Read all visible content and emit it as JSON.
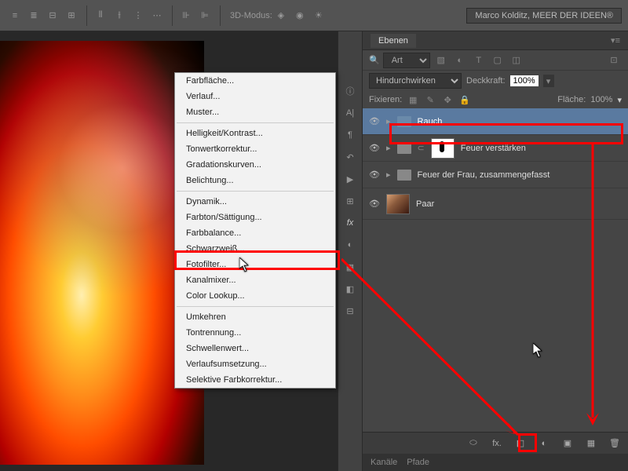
{
  "top": {
    "mode3d_label": "3D-Modus:",
    "author": "Marco Kolditz, MEER DER IDEEN®"
  },
  "context_menu": {
    "items": [
      "Farbfläche...",
      "Verlauf...",
      "Muster...",
      "Helligkeit/Kontrast...",
      "Tonwertkorrektur...",
      "Gradationskurven...",
      "Belichtung...",
      "Dynamik...",
      "Farbton/Sättigung...",
      "Farbbalance...",
      "Schwarzweiß...",
      "Fotofilter...",
      "Kanalmixer...",
      "Color Lookup...",
      "Umkehren",
      "Tontrennung...",
      "Schwellenwert...",
      "Verlaufsumsetzung...",
      "Selektive Farbkorrektur..."
    ],
    "highlighted_index": 9,
    "separators_after": [
      2,
      6,
      13
    ]
  },
  "layers_panel": {
    "tab": "Ebenen",
    "search_placeholder": "Art",
    "blend_mode": "Hindurchwirken",
    "opacity_label": "Deckkraft:",
    "opacity_value": "100%",
    "lock_label": "Fixieren:",
    "fill_label": "Fläche:",
    "fill_value": "100%",
    "layers": [
      {
        "name": "Rauch",
        "type": "group",
        "selected": true
      },
      {
        "name": "Feuer verstärken",
        "type": "group_masked"
      },
      {
        "name": "Feuer der Frau, zusammengefasst",
        "type": "group"
      },
      {
        "name": "Paar",
        "type": "image"
      }
    ]
  },
  "lower_tabs": {
    "t1": "Kanäle",
    "t2": "Pfade"
  },
  "icons": {
    "link": "⬭",
    "fx": "fx.",
    "mask": "◧",
    "adj": "◐",
    "folder": "▣",
    "new": "▦",
    "trash": "🗑"
  }
}
